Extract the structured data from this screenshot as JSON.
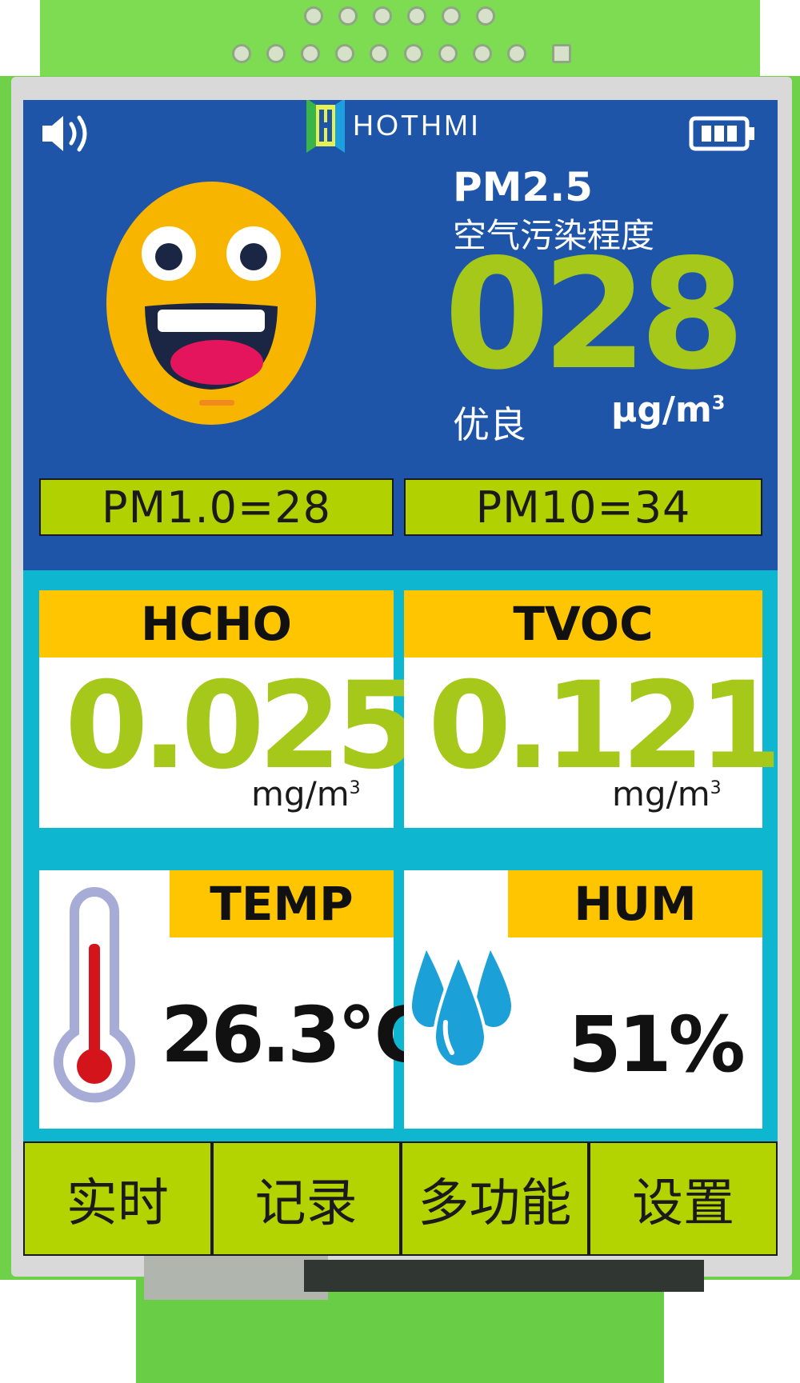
{
  "header": {
    "brand": "HOTHMI",
    "speaker_icon": "speaker-icon",
    "battery_icon": "battery-icon"
  },
  "pm25": {
    "title": "PM2.5",
    "subtitle": "空气污染程度",
    "value": "028",
    "level": "优良",
    "unit": "μg/m",
    "unit_sup": "3",
    "face_icon": "smiley-face-icon"
  },
  "pm_small": {
    "pm10_label": "PM1.0=28",
    "pm100_label": "PM10=34"
  },
  "hcho": {
    "label": "HCHO",
    "value": "0.025",
    "unit": "mg/m",
    "unit_sup": "3"
  },
  "tvoc": {
    "label": "TVOC",
    "value": "0.121",
    "unit": "mg/m",
    "unit_sup": "3"
  },
  "temp": {
    "label": "TEMP",
    "value": "26.3℃",
    "icon": "thermometer-icon"
  },
  "hum": {
    "label": "HUM",
    "value": "51%",
    "icon": "water-drops-icon"
  },
  "nav": {
    "items": [
      "实时",
      "记录",
      "多功能",
      "设置"
    ]
  },
  "colors": {
    "top_panel": "#1e55a8",
    "accent_lime": "#b2d100",
    "value_green": "#a5c81a",
    "header_yellow": "#ffc600",
    "frame_cyan": "#0fb6d0",
    "pcb_green": "#6fd04a"
  }
}
